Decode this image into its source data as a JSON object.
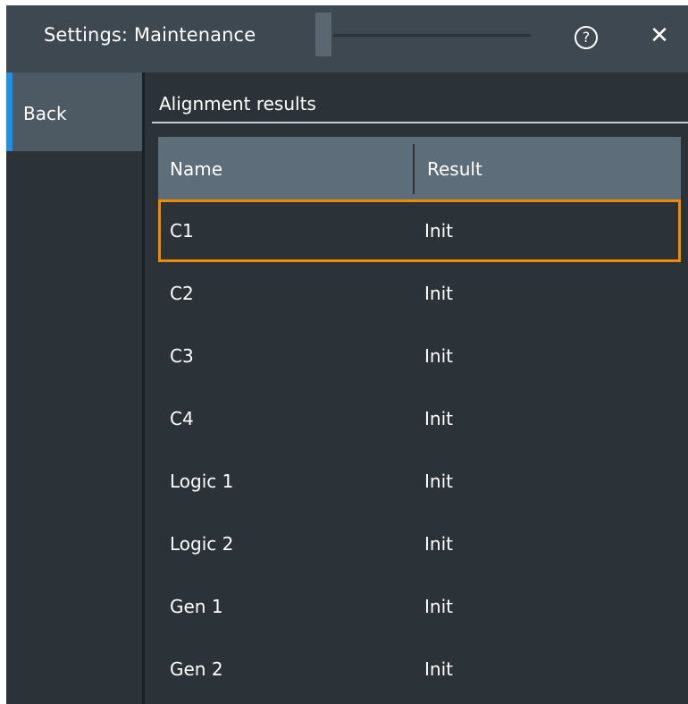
{
  "window": {
    "title": "Settings: Maintenance",
    "help_glyph": "?",
    "close_glyph": "✕"
  },
  "sidebar": {
    "back_label": "Back"
  },
  "section": {
    "title": "Alignment results"
  },
  "table": {
    "columns": [
      "Name",
      "Result"
    ],
    "rows": [
      {
        "name": "C1",
        "result": "Init",
        "selected": true
      },
      {
        "name": "C2",
        "result": "Init",
        "selected": false
      },
      {
        "name": "C3",
        "result": "Init",
        "selected": false
      },
      {
        "name": "C4",
        "result": "Init",
        "selected": false
      },
      {
        "name": "Logic 1",
        "result": "Init",
        "selected": false
      },
      {
        "name": "Logic 2",
        "result": "Init",
        "selected": false
      },
      {
        "name": "Gen 1",
        "result": "Init",
        "selected": false
      },
      {
        "name": "Gen 2",
        "result": "Init",
        "selected": false
      }
    ]
  },
  "icons": {
    "help": "help-circle-icon",
    "close": "close-icon"
  },
  "colors": {
    "accent": "#1e90e6",
    "selection": "#f08a00",
    "header_bg": "#5d6d79",
    "background": "#2b3339"
  }
}
